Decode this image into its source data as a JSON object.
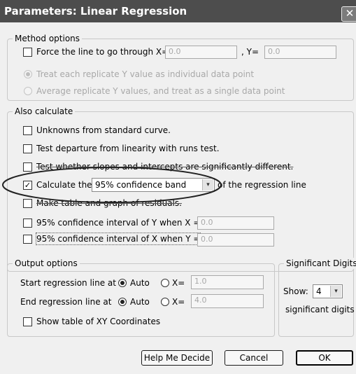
{
  "window": {
    "title": "Parameters: Linear Regression",
    "close_glyph": "✕"
  },
  "method_options": {
    "legend": "Method options",
    "force_line": {
      "label": "Force the line to go through X=",
      "checked": false,
      "x_value": "0.0",
      "y_label": ", Y=",
      "y_value": "0.0"
    },
    "replicate_individual": {
      "label": "Treat each replicate Y value as individual data point",
      "selected": true,
      "enabled": false
    },
    "replicate_average": {
      "label": "Average replicate Y values, and treat as a single data point",
      "selected": false,
      "enabled": false
    }
  },
  "also_calculate": {
    "legend": "Also calculate",
    "unknowns": {
      "label": "Unknowns from standard curve.",
      "checked": false
    },
    "runs_test": {
      "label": "Test departure from linearity with runs test.",
      "checked": false
    },
    "slopes_test": {
      "label": "Test whether slopes and intercepts are significantly different.",
      "checked": false
    },
    "confidence": {
      "label_before": "Calculate the",
      "selected": "95% confidence band",
      "label_after": "of the regression line",
      "checked": true,
      "check_glyph": "✓",
      "arrow_glyph": "▾"
    },
    "residuals": {
      "label": "Make table and graph of residuals.",
      "checked": false
    },
    "ci_y": {
      "label": "95% confidence interval of Y when X =",
      "value": "0.0",
      "checked": false
    },
    "ci_x": {
      "label": "95% confidence interval of X when Y =",
      "value": "0.0",
      "checked": false
    }
  },
  "output_options": {
    "legend": "Output options",
    "start": {
      "label": "Start regression line at",
      "auto_label": "Auto",
      "x_label": "X=",
      "value": "1.0",
      "auto_selected": true
    },
    "end": {
      "label": "End regression line at",
      "auto_label": "Auto",
      "x_label": "X=",
      "value": "4.0",
      "auto_selected": true
    },
    "show_table": {
      "label": "Show table of XY Coordinates",
      "checked": false
    }
  },
  "significant_digits": {
    "legend": "Significant Digits",
    "show_label": "Show:",
    "value": "4",
    "suffix": "significant digits",
    "arrow_glyph": "▾"
  },
  "buttons": {
    "help": "Help Me Decide",
    "cancel": "Cancel",
    "ok": "OK"
  },
  "annotation": {
    "color": "#222222",
    "shape": "ellipse"
  }
}
